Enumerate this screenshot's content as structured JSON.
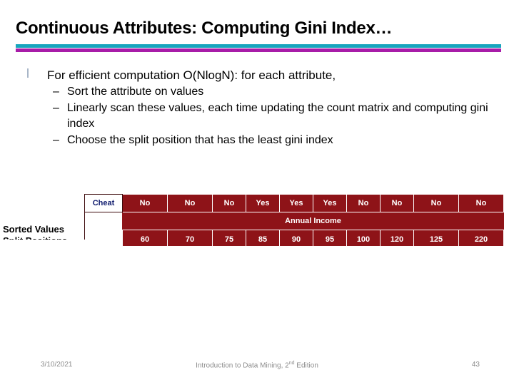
{
  "slide": {
    "title": "Continuous Attributes: Computing Gini Index…",
    "divider": {
      "top_color": "#17A5BE",
      "bottom_color": "#A81CA8"
    }
  },
  "body": {
    "bullet1": {
      "text": "For efficient computation O(NlogN): for each attribute,",
      "marker": "|"
    },
    "sub_bullets": [
      {
        "marker": "–",
        "text": "Sort the attribute on values"
      },
      {
        "marker": "–",
        "text": "Linearly scan these values, each time updating the count matrix and computing gini index"
      },
      {
        "marker": "–",
        "text": "Choose the split position that has the least gini index"
      }
    ]
  },
  "table_graphic": {
    "row_label": "Cheat",
    "income_header": "Annual Income",
    "cheat_values": [
      "No",
      "No",
      "No",
      "Yes",
      "Yes",
      "Yes",
      "No",
      "No",
      "No",
      "No"
    ],
    "income_values": [
      "60",
      "70",
      "75",
      "85",
      "90",
      "95",
      "100",
      "120",
      "125",
      "220"
    ],
    "colors": {
      "cell_fill": "#8E1318",
      "cell_text": "#ffffff",
      "label_text": "#101C6E",
      "border": "#3D0A0C"
    },
    "labels": {
      "sorted_values": "Sorted Values",
      "split_positions": "Split Positions",
      "arrow": "right-arrow-icon",
      "arrow_color": "#0E6A63"
    }
  },
  "footer": {
    "date": "3/10/2021",
    "center_text_before": "Introduction to Data Mining, 2",
    "center_superscript": "nd",
    "center_text_after": " Edition",
    "page_number": "43"
  }
}
